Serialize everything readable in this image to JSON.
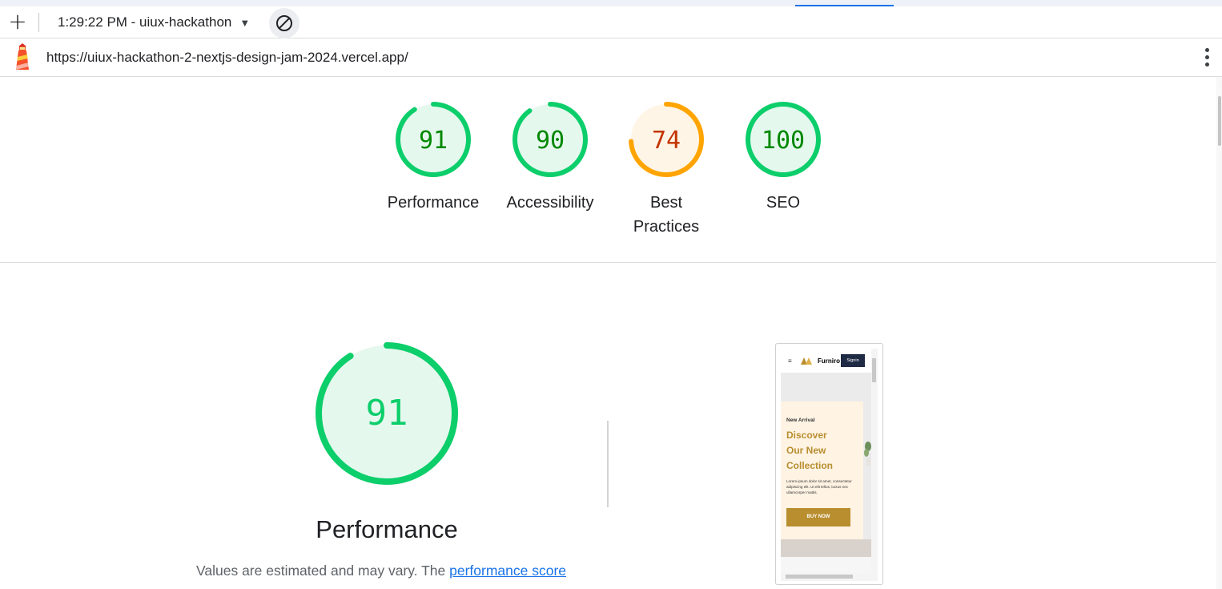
{
  "toolbar": {
    "add_label": "+",
    "report_title": "1:29:22 PM - uiux-hackathon",
    "caret": "▼"
  },
  "urlbar": {
    "url": "https://uiux-hackathon-2-nextjs-design-jam-2024.vercel.app/"
  },
  "gauges": [
    {
      "score": "91",
      "label": "Performance",
      "value": 91,
      "color": "#0cce6b",
      "text_color": "#008800",
      "bg": "#e5f8ee"
    },
    {
      "score": "90",
      "label": "Accessibility",
      "value": 90,
      "color": "#0cce6b",
      "text_color": "#008800",
      "bg": "#e5f8ee"
    },
    {
      "score": "74",
      "label_line1": "Best",
      "label_line2": "Practices",
      "value": 74,
      "color": "#ffa400",
      "text_color": "#c33300",
      "bg": "#fff5e6"
    },
    {
      "score": "100",
      "label": "SEO",
      "value": 100,
      "color": "#0cce6b",
      "text_color": "#008800",
      "bg": "#e5f8ee"
    }
  ],
  "performance": {
    "score": "91",
    "value": 91,
    "title": "Performance",
    "desc_prefix": "Values are estimated and may vary. The ",
    "desc_link": "performance score"
  },
  "screenshot": {
    "brand": "Furniro",
    "signin": "Signin",
    "new_arrival": "New Arrival",
    "heading_line1": "Discover",
    "heading_line2": "Our New",
    "heading_line3": "Collection",
    "lorem": "Lorem ipsum dolor sit amet, consectetur adipiscing elit. Ut elit tellus, luctus nec ullamcorper mattis.",
    "buy_now": "BUY NOW"
  }
}
